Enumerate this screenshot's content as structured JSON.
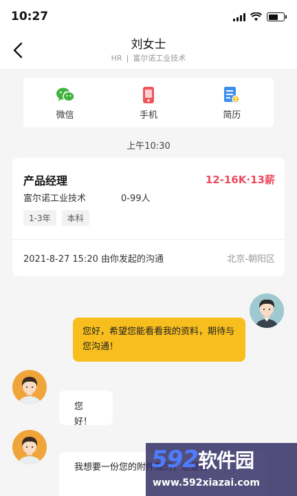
{
  "status": {
    "time": "10:27"
  },
  "header": {
    "title": "刘女士",
    "role": "HR",
    "separator": "|",
    "company": "富尔诺工业技术"
  },
  "contact": {
    "items": [
      {
        "label": "微信",
        "icon": "wechat-icon"
      },
      {
        "label": "手机",
        "icon": "phone-icon"
      },
      {
        "label": "简历",
        "icon": "resume-icon"
      }
    ]
  },
  "timestamp": "上午10:30",
  "job": {
    "title": "产品经理",
    "salary": "12-16K·13薪",
    "company": "富尔诺工业技术",
    "size": "0-99人",
    "tags": [
      "1-3年",
      "本科"
    ],
    "meta": "2021-8-27  15:20 由你发起的沟通",
    "location": "北京-朝阳区"
  },
  "messages": [
    {
      "from": "me",
      "text": "您好，希望您能看看我的资料，期待与您沟通！"
    },
    {
      "from": "hr",
      "text": "您好！"
    },
    {
      "from": "hr",
      "text": "我想要一份您的附件简历，您是否"
    }
  ],
  "colors": {
    "accent": "#f7be1e",
    "salary": "#ee4a5d",
    "wechat": "#3fb23f",
    "phone": "#f0555a",
    "resume": "#3b8ef0"
  },
  "watermark": {
    "brand_num": "592",
    "brand_cn": "软件园",
    "url": "www.592xiazai.com"
  }
}
